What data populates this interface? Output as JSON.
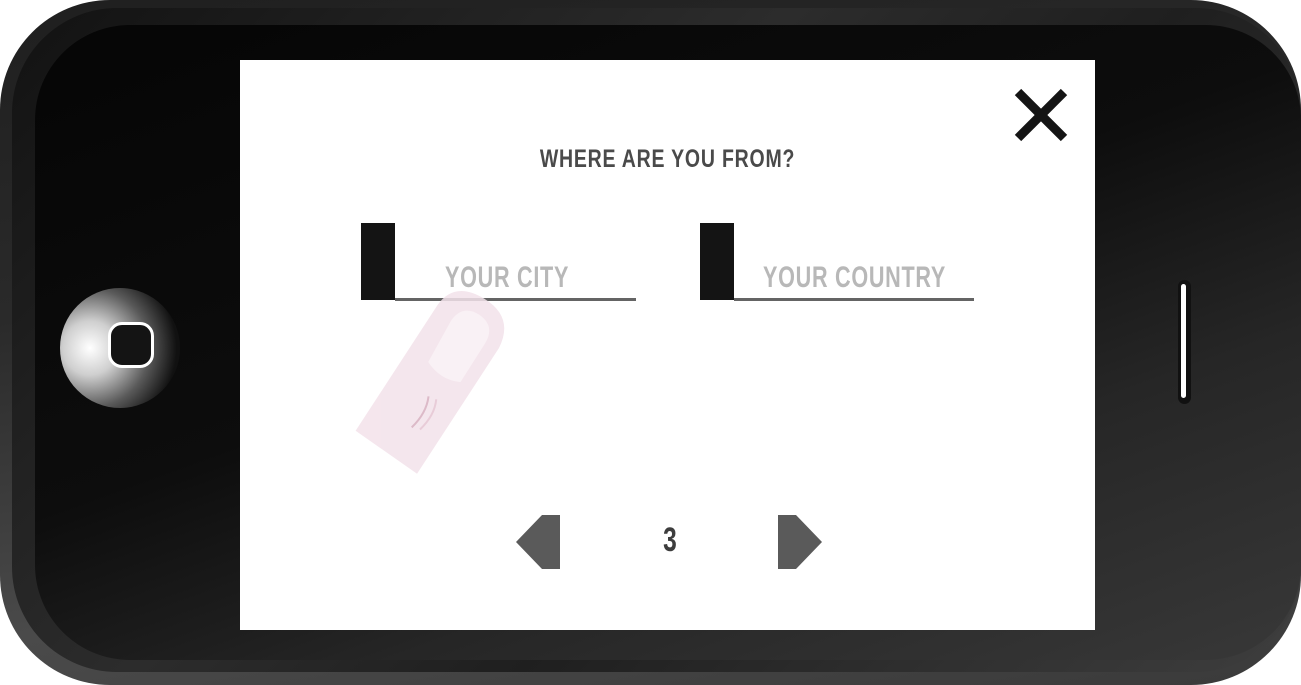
{
  "dialog": {
    "question": "WHERE ARE YOU FROM?",
    "city_placeholder": "YOUR CITY",
    "country_placeholder": "YOUR COUNTRY",
    "page_number": "3"
  },
  "icons": {
    "close": "close-icon",
    "previous": "previous-arrow-icon",
    "next": "next-arrow-icon",
    "home": "home-button-icon",
    "finger": "finger-tap-icon"
  },
  "colors": {
    "screen_background": "#ffffff",
    "text_dark": "#4a4a4a",
    "placeholder": "#b8b8b8",
    "cursor_block": "#141414",
    "underline": "#646464",
    "arrow": "#5a5a5a",
    "finger": "#f3e2ea"
  }
}
